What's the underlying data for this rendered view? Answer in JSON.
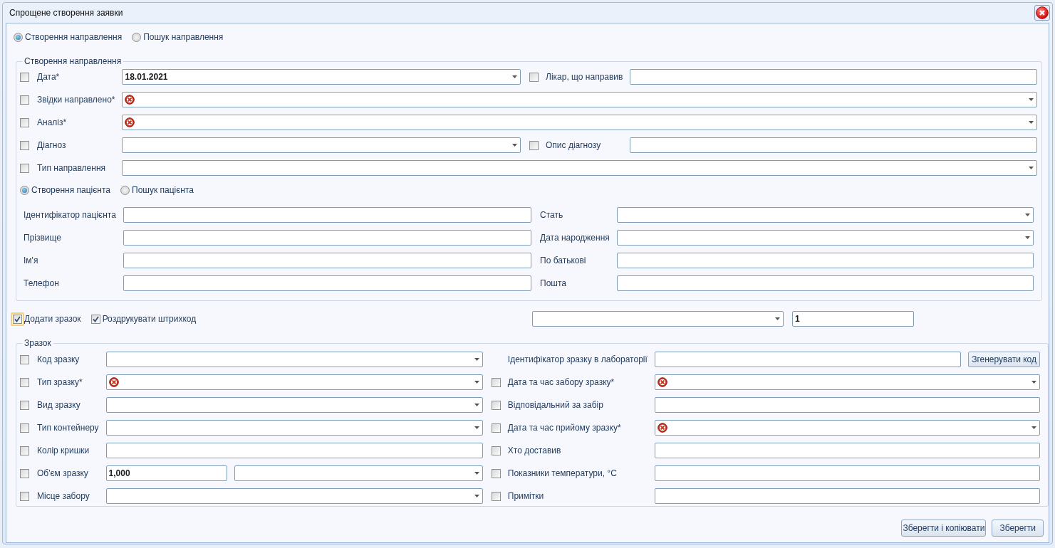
{
  "window": {
    "title": "Спрощене створення заявки"
  },
  "modes": [
    {
      "label": "Створення направлення",
      "selected": true
    },
    {
      "label": "Пошук направлення",
      "selected": false
    }
  ],
  "referral": {
    "title": "Створення направлення",
    "rows": [
      {
        "items": [
          {
            "label": "Дата*",
            "checked": false,
            "inputs": [
              {
                "kind": "combo",
                "value": "18.01.2021",
                "invalid": false
              }
            ]
          },
          {
            "label": "Лікар, що направив",
            "checked": false,
            "inputs": [
              {
                "kind": "text",
                "invalid": false
              }
            ]
          }
        ]
      },
      {
        "items": [
          {
            "label": "Звідки направлено*",
            "checked": false,
            "inputs": [
              {
                "kind": "combo",
                "invalid": true
              }
            ]
          }
        ]
      },
      {
        "items": [
          {
            "label": "Аналіз*",
            "checked": false,
            "inputs": [
              {
                "kind": "combo",
                "invalid": true
              }
            ]
          }
        ]
      },
      {
        "items": [
          {
            "label": "Діагноз",
            "checked": false,
            "inputs": [
              {
                "kind": "combo",
                "invalid": false
              }
            ]
          },
          {
            "label": "Опис діагнозу",
            "checked": false,
            "inputs": [
              {
                "kind": "text",
                "invalid": false
              }
            ]
          }
        ]
      },
      {
        "items": [
          {
            "label": "Тип направлення",
            "checked": false,
            "inputs": [
              {
                "kind": "combo",
                "invalid": false
              }
            ]
          }
        ]
      }
    ],
    "patient_modes": [
      {
        "label": "Створення пацієнта",
        "selected": true
      },
      {
        "label": "Пошук пацієнта",
        "selected": false
      }
    ],
    "patient_rows": [
      {
        "items": [
          {
            "label": "Ідентифікатор пацієнта",
            "inputs": [
              {
                "kind": "text",
                "invalid": false
              }
            ]
          },
          {
            "label": "Стать",
            "inputs": [
              {
                "kind": "combo",
                "invalid": false
              }
            ]
          }
        ]
      },
      {
        "items": [
          {
            "label": "Прізвище",
            "inputs": [
              {
                "kind": "text",
                "invalid": false
              }
            ]
          },
          {
            "label": "Дата народження",
            "inputs": [
              {
                "kind": "combo",
                "invalid": false
              }
            ]
          }
        ]
      },
      {
        "items": [
          {
            "label": "Ім'я",
            "inputs": [
              {
                "kind": "text",
                "invalid": false
              }
            ]
          },
          {
            "label": "По батькові",
            "inputs": [
              {
                "kind": "text",
                "invalid": false
              }
            ]
          }
        ]
      },
      {
        "items": [
          {
            "label": "Телефон",
            "inputs": [
              {
                "kind": "text",
                "invalid": false
              }
            ]
          },
          {
            "label": "Пошта",
            "inputs": [
              {
                "kind": "text",
                "invalid": false
              }
            ]
          }
        ]
      }
    ]
  },
  "options": {
    "checkboxes": [
      {
        "label": "Додати зразок",
        "checked": true,
        "focused": true
      },
      {
        "label": "Роздрукувати штрихкод",
        "checked": true,
        "focused": false
      }
    ],
    "inputs": [
      {
        "kind": "combo",
        "invalid": false
      },
      {
        "kind": "text",
        "value": "1",
        "invalid": false
      }
    ]
  },
  "sample": {
    "title": "Зразок",
    "rows": [
      {
        "items": [
          {
            "label": "Код зразку",
            "checked": false,
            "inputs": [
              {
                "kind": "combo",
                "invalid": false
              }
            ]
          },
          {
            "label": "Ідентифікатор зразку в лабораторії",
            "inputs": [
              {
                "kind": "text",
                "invalid": false
              },
              {
                "kind": "button",
                "label": "Згенерувати код"
              }
            ]
          }
        ]
      },
      {
        "items": [
          {
            "label": "Тип зразку*",
            "checked": false,
            "inputs": [
              {
                "kind": "combo",
                "invalid": true
              }
            ]
          },
          {
            "label": "Дата та час забору зразку*",
            "checked": false,
            "inputs": [
              {
                "kind": "combo",
                "invalid": true
              }
            ]
          }
        ]
      },
      {
        "items": [
          {
            "label": "Вид зразку",
            "checked": false,
            "inputs": [
              {
                "kind": "combo",
                "invalid": false
              }
            ]
          },
          {
            "label": "Відповідальний за забір",
            "checked": false,
            "inputs": [
              {
                "kind": "text",
                "invalid": false
              }
            ]
          }
        ]
      },
      {
        "items": [
          {
            "label": "Тип контейнеру",
            "checked": false,
            "inputs": [
              {
                "kind": "combo",
                "invalid": false
              }
            ]
          },
          {
            "label": "Дата та час прийому зразку*",
            "checked": false,
            "inputs": [
              {
                "kind": "combo",
                "invalid": true
              }
            ]
          }
        ]
      },
      {
        "items": [
          {
            "label": "Колір кришки",
            "checked": false,
            "inputs": [
              {
                "kind": "text",
                "invalid": false
              }
            ]
          },
          {
            "label": "Хто доставив",
            "checked": false,
            "inputs": [
              {
                "kind": "text",
                "invalid": false
              }
            ]
          }
        ]
      },
      {
        "items": [
          {
            "label": "Об'єм зразку",
            "checked": false,
            "inputs": [
              {
                "kind": "text",
                "value": "1,000",
                "invalid": false
              },
              {
                "kind": "combo",
                "invalid": false
              }
            ]
          },
          {
            "label": "Показники температури, °C",
            "checked": false,
            "inputs": [
              {
                "kind": "text",
                "invalid": false
              }
            ]
          }
        ]
      },
      {
        "items": [
          {
            "label": "Місце забору",
            "checked": false,
            "inputs": [
              {
                "kind": "combo",
                "invalid": false
              }
            ]
          },
          {
            "label": "Примітки",
            "checked": false,
            "inputs": [
              {
                "kind": "text",
                "invalid": false
              }
            ]
          }
        ]
      }
    ]
  },
  "buttons": [
    "Зберегти і копіювати",
    "Зберегти"
  ]
}
